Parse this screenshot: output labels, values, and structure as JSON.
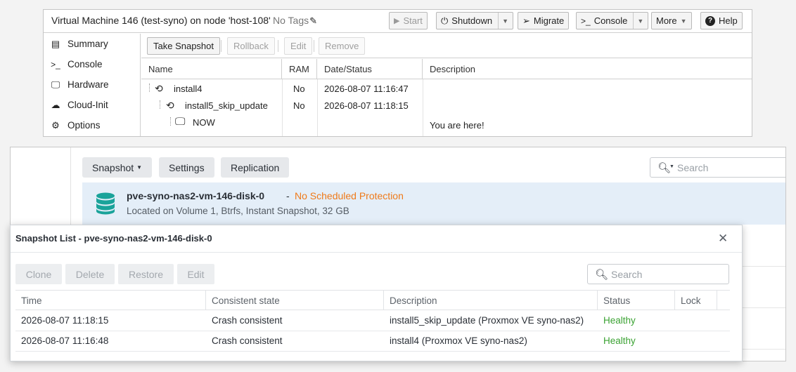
{
  "pve": {
    "title": "Virtual Machine 146 (test-syno) on node 'host-108'",
    "tags": "No Tags",
    "buttons": {
      "start": "Start",
      "shutdown": "Shutdown",
      "migrate": "Migrate",
      "console": "Console",
      "more": "More",
      "help": "Help"
    },
    "sidebar": [
      {
        "label": "Summary",
        "icon": "book-icon"
      },
      {
        "label": "Console",
        "icon": "terminal-icon"
      },
      {
        "label": "Hardware",
        "icon": "monitor-icon"
      },
      {
        "label": "Cloud-Init",
        "icon": "cloud-icon"
      },
      {
        "label": "Options",
        "icon": "gear-icon"
      }
    ],
    "toolbar": {
      "take_snapshot": "Take Snapshot",
      "rollback": "Rollback",
      "edit": "Edit",
      "remove": "Remove"
    },
    "grid": {
      "headers": [
        "Name",
        "RAM",
        "Date/Status",
        "Description"
      ],
      "rows": [
        {
          "name": "install4",
          "ram": "No",
          "date": "2026-08-07 11:16:47",
          "desc": ""
        },
        {
          "name": "install5_skip_update",
          "ram": "No",
          "date": "2026-08-07 11:18:15",
          "desc": ""
        },
        {
          "name": "NOW",
          "ram": "",
          "date": "",
          "desc": "You are here!"
        }
      ]
    }
  },
  "syn": {
    "buttons": {
      "snapshot": "Snapshot",
      "settings": "Settings",
      "replication": "Replication"
    },
    "search_placeholder": "Search",
    "volume": {
      "name": "pve-syno-nas2-vm-146-disk-0",
      "dash": "-",
      "protection": "No Scheduled Protection",
      "sub": "Located on Volume 1, Btrfs, Instant Snapshot, 32 GB"
    }
  },
  "dialog": {
    "title": "Snapshot List - pve-syno-nas2-vm-146-disk-0",
    "buttons": {
      "clone": "Clone",
      "delete": "Delete",
      "restore": "Restore",
      "edit": "Edit"
    },
    "search_placeholder": "Search",
    "headers": [
      "Time",
      "Consistent state",
      "Description",
      "Status",
      "Lock"
    ],
    "rows": [
      {
        "time": "2026-08-07 11:18:15",
        "state": "Crash consistent",
        "desc": "install5_skip_update (Proxmox VE syno-nas2)",
        "status": "Healthy",
        "lock": ""
      },
      {
        "time": "2026-08-07 11:16:48",
        "state": "Crash consistent",
        "desc": "install4 (Proxmox VE syno-nas2)",
        "status": "Healthy",
        "lock": ""
      }
    ]
  },
  "colors": {
    "orange": "#ef7a1a",
    "healthy": "#3aa232",
    "selected": "#e4eef8"
  }
}
